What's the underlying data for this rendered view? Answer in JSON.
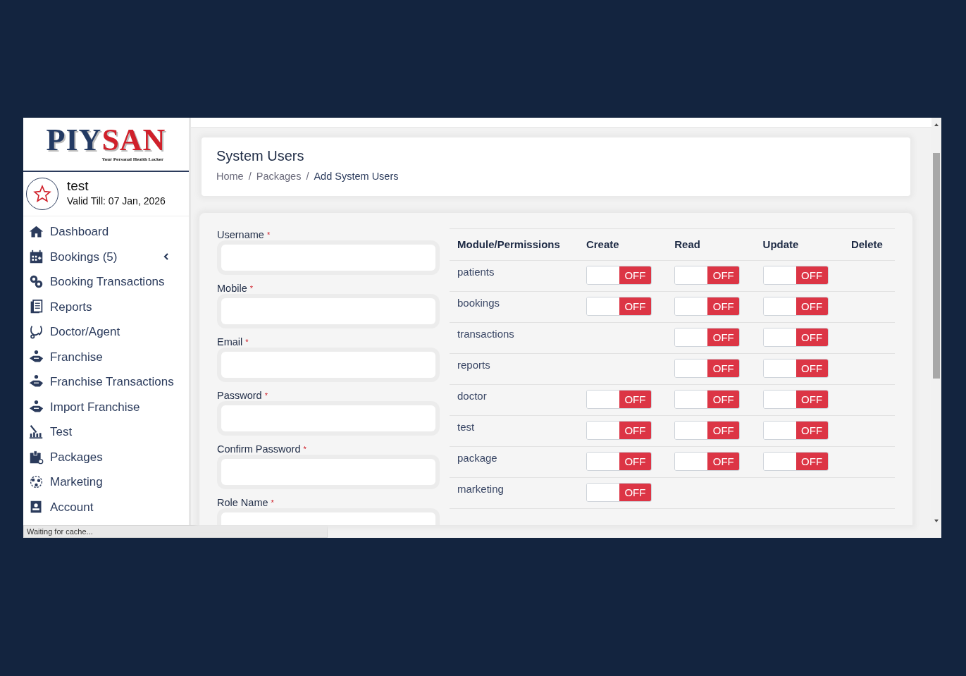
{
  "sidebar": {
    "logo": {
      "brand_part_1": "PIY",
      "brand_part_2": "SAN",
      "tagline": "Your Personal Health Locker"
    },
    "user": {
      "name": "test",
      "validity": "Valid Till: 07 Jan, 2026"
    },
    "items": [
      {
        "label": "Dashboard",
        "kind": "link"
      },
      {
        "label": "Bookings (5)",
        "kind": "group",
        "expanded": false
      },
      {
        "label": "Booking Transactions",
        "kind": "link"
      },
      {
        "label": "Reports",
        "kind": "link"
      },
      {
        "label": "Doctor/Agent",
        "kind": "link"
      },
      {
        "label": "Franchise",
        "kind": "link"
      },
      {
        "label": "Franchise Transactions",
        "kind": "link"
      },
      {
        "label": "Import Franchise",
        "kind": "link"
      },
      {
        "label": "Test",
        "kind": "link"
      },
      {
        "label": "Packages",
        "kind": "link"
      },
      {
        "label": "Marketing",
        "kind": "link"
      },
      {
        "label": "Account",
        "kind": "link"
      }
    ]
  },
  "header": {
    "title": "System Users",
    "breadcrumb": [
      {
        "kind": "link",
        "label": "Home"
      },
      {
        "kind": "separator",
        "label": "/"
      },
      {
        "kind": "link",
        "label": "Packages"
      },
      {
        "kind": "separator",
        "label": "/"
      },
      {
        "kind": "current",
        "label": "Add System Users"
      }
    ]
  },
  "form": {
    "fields": [
      {
        "label": "Username",
        "required_mark": "*"
      },
      {
        "label": "Mobile",
        "required_mark": "*"
      },
      {
        "label": "Email",
        "required_mark": "*"
      },
      {
        "label": "Password",
        "required_mark": "*"
      },
      {
        "label": "Confirm Password",
        "required_mark": "*"
      },
      {
        "label": "Role Name",
        "required_mark": "*"
      }
    ]
  },
  "permissions": {
    "columns": [
      "Module/Permissions",
      "Create",
      "Read",
      "Update",
      "Delete"
    ],
    "rows": [
      {
        "cells": [
          "patients",
          {
            "label": "OFF",
            "on": false
          },
          {
            "label": "OFF",
            "on": false
          },
          {
            "label": "OFF",
            "on": false
          },
          ""
        ]
      },
      {
        "cells": [
          "bookings",
          {
            "label": "OFF",
            "on": false
          },
          {
            "label": "OFF",
            "on": false
          },
          {
            "label": "OFF",
            "on": false
          },
          ""
        ]
      },
      {
        "cells": [
          "transactions",
          "",
          {
            "label": "OFF",
            "on": false
          },
          {
            "label": "OFF",
            "on": false
          },
          ""
        ]
      },
      {
        "cells": [
          "reports",
          "",
          {
            "label": "OFF",
            "on": false
          },
          {
            "label": "OFF",
            "on": false
          },
          ""
        ]
      },
      {
        "cells": [
          "doctor",
          {
            "label": "OFF",
            "on": false
          },
          {
            "label": "OFF",
            "on": false
          },
          {
            "label": "OFF",
            "on": false
          },
          ""
        ]
      },
      {
        "cells": [
          "test",
          {
            "label": "OFF",
            "on": false
          },
          {
            "label": "OFF",
            "on": false
          },
          {
            "label": "OFF",
            "on": false
          },
          ""
        ]
      },
      {
        "cells": [
          "package",
          {
            "label": "OFF",
            "on": false
          },
          {
            "label": "OFF",
            "on": false
          },
          {
            "label": "OFF",
            "on": false
          },
          ""
        ]
      },
      {
        "cells": [
          "marketing",
          {
            "label": "OFF",
            "on": false
          },
          "",
          "",
          ""
        ]
      }
    ]
  },
  "status_bar": {
    "text": "Waiting for cache..."
  }
}
